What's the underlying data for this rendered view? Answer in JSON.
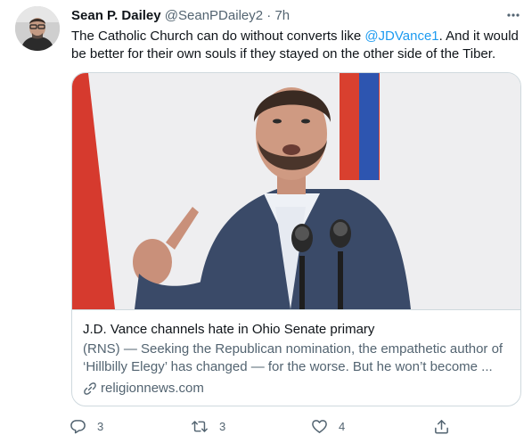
{
  "author": {
    "name": "Sean P. Dailey",
    "handle": "@SeanPDailey2",
    "separator": "·",
    "time": "7h"
  },
  "tweet": {
    "text_before": "The Catholic Church can do without converts like ",
    "mention": "@JDVance1",
    "text_after": ". And it would be better for their own souls if they stayed on the other side of the Tiber."
  },
  "card": {
    "title": "J.D. Vance channels hate in Ohio Senate primary",
    "description_line1": "(RNS) — Seeking the Republican nomination, the empathetic author of",
    "description_line2": "‘Hillbilly Elegy’ has changed — for the worse. But he won’t become ...",
    "domain": "religionnews.com"
  },
  "actions": {
    "reply_count": "3",
    "retweet_count": "3",
    "like_count": "4"
  },
  "colors": {
    "accent": "#1d9bf0",
    "text_primary": "#0f1419",
    "text_secondary": "#536471",
    "border": "#cfd9de"
  },
  "icons": [
    "more-icon",
    "reply-icon",
    "retweet-icon",
    "like-icon",
    "share-icon",
    "link-icon"
  ]
}
